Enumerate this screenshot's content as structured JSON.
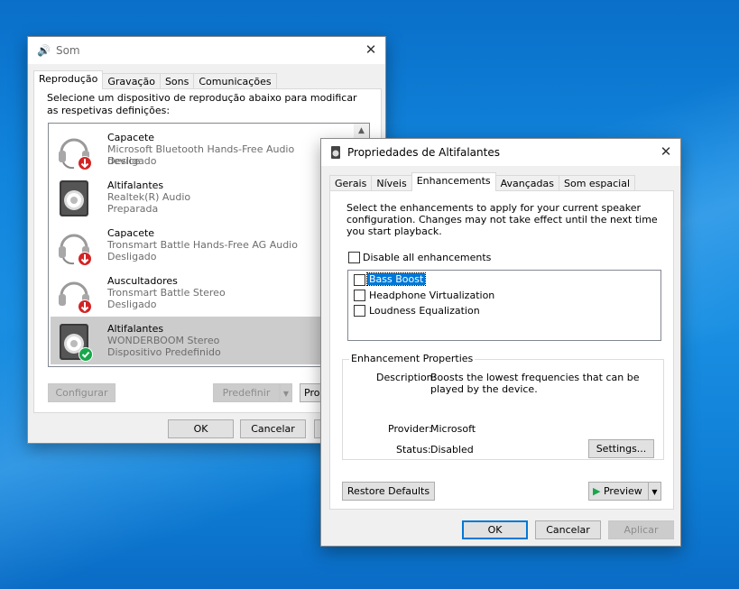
{
  "som": {
    "title": "Som",
    "tabs": [
      "Reprodução",
      "Gravação",
      "Sons",
      "Comunicações"
    ],
    "instruction": "Selecione um dispositivo de reprodução abaixo para modificar as respetivas definições:",
    "devices": [
      {
        "name": "Capacete",
        "detail": "Microsoft Bluetooth Hands-Free Audio device",
        "state": "Desligado",
        "icon": "headset-icon"
      },
      {
        "name": "Altifalantes",
        "detail": "Realtek(R) Audio",
        "state": "Preparada",
        "icon": "speaker-icon"
      },
      {
        "name": "Capacete",
        "detail": "Tronsmart  Battle Hands-Free AG Audio",
        "state": "Desligado",
        "icon": "headset-icon"
      },
      {
        "name": "Auscultadores",
        "detail": "Tronsmart  Battle Stereo",
        "state": "Desligado",
        "icon": "headphones-icon"
      },
      {
        "name": "Altifalantes",
        "detail": "WONDERBOOM Stereo",
        "state": "Dispositivo Predefinido",
        "icon": "speaker-icon"
      }
    ],
    "configure_label": "Configurar",
    "set_default_label": "Predefinir",
    "properties_label": "Pro",
    "ok_label": "OK",
    "cancel_label": "Cancelar"
  },
  "props": {
    "title": "Propriedades de Altifalantes",
    "tabs": [
      "Gerais",
      "Níveis",
      "Enhancements",
      "Avançadas",
      "Som espacial"
    ],
    "intro": "Select the enhancements to apply for your current speaker configuration. Changes may not take effect until the next time you start playback.",
    "disable_all_label": "Disable all enhancements",
    "enhancements": [
      "Bass Boost",
      "Headphone Virtualization",
      "Loudness Equalization"
    ],
    "properties_group_label": "Enhancement Properties",
    "description_label": "Description:",
    "description_value": "Boosts the lowest frequencies that can be played by the device.",
    "provider_label": "Provider:",
    "provider_value": "Microsoft",
    "status_label": "Status:",
    "status_value": "Disabled",
    "settings_label": "Settings...",
    "restore_label": "Restore Defaults",
    "preview_label": "Preview",
    "ok_label": "OK",
    "cancel_label": "Cancelar",
    "apply_label": "Aplicar"
  },
  "colors": {
    "accent": "#0078d7",
    "selection": "#cccccc",
    "default_check": "#17a74a",
    "red_arrow": "#d32424"
  }
}
